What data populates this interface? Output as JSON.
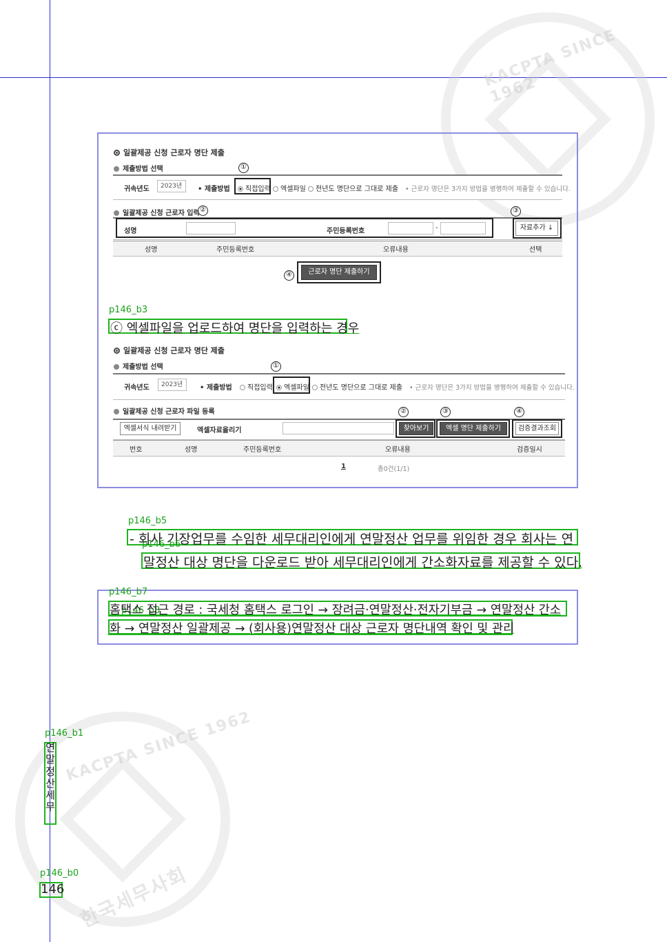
{
  "page": {
    "page_number": "146",
    "side_title": "연말정산 세무",
    "watermark_text": "KACPTA SINCE 1962",
    "watermark_kr": "한국세무사회"
  },
  "blocks": {
    "b0": "p146_b0",
    "b1": "p146_b1",
    "b3": "p146_b3",
    "b5": "p146_b5",
    "b6": "p146_b6",
    "b7": "p146_b7",
    "b8": "p146_b8"
  },
  "text": {
    "heading_excel": "ⓒ 엑셀파일을 업로드하여 명단을 입력하는 경우",
    "para_line1": "- 회사 기장업무를 수임한 세무대리인에게 연말정산 업무를 위임한 경우 회사는 연",
    "para_line2": "말정산 대상 명단을 다운로드 받아 세무대리인에게 간소화자료를 제공할 수 있다.",
    "box_line1": "홈택스 접근 경로 : 국세청 홈택스 로그인 → 장려금·연말정산·전자기부금 → 연말정산 간소",
    "box_line2": "화 → 연말정산 일괄제공 → (회사용)연말정산 대상 근로자 명단내역 확인 및 관리"
  },
  "form1": {
    "title": "일괄제공 신청 근로자 명단 제출",
    "section1": "제출방법 선택",
    "year_label": "귀속년도",
    "year_value": "2023년",
    "method_label": "• 제출방법",
    "opt_direct": "직접입력",
    "opt_excel": "엑셀파일",
    "opt_prev": "전년도 명단으로 그대로 제출",
    "note": "• 근로자 명단은 3가지 방법을 병행하여 제출할 수 있습니다.",
    "section2": "일괄제공 신청 근로자 입력",
    "name_label": "성명",
    "rrn_label": "주민등록번호",
    "rrn_dash": "-",
    "add_button": "자료추가 ↓",
    "col_name": "성명",
    "col_rrn": "주민등록번호",
    "col_error": "오류내용",
    "col_select": "선택",
    "submit_button": "근로자 명단 제출하기",
    "marks": [
      "①",
      "②",
      "③",
      "④"
    ]
  },
  "form2": {
    "title": "일괄제공 신청 근로자 명단 제출",
    "section1": "제출방법 선택",
    "year_label": "귀속년도",
    "year_value": "2023년",
    "method_label": "• 제출방법",
    "opt_direct": "직접입력",
    "opt_excel": "엑셀파일",
    "opt_prev": "전년도 명단으로 그대로 제출",
    "note": "• 근로자 명단은 3가지 방법을 병행하여 제출할 수 있습니다.",
    "section2": "일괄제공 신청 근로자 파일 등록",
    "download_button": "엑셀서식 내려받기",
    "upload_label": "엑셀자료올리기",
    "browse_button": "찾아보기",
    "excel_submit_button": "엑셀 명단 제출하기",
    "verify_button": "검증결과조회",
    "col_no": "번호",
    "col_name": "성명",
    "col_rrn": "주민등록번호",
    "col_error": "오류내용",
    "col_date": "검증일시",
    "page_num": "1",
    "page_total": "총0건(1/1)",
    "marks": [
      "①",
      "②",
      "③",
      "④"
    ]
  }
}
